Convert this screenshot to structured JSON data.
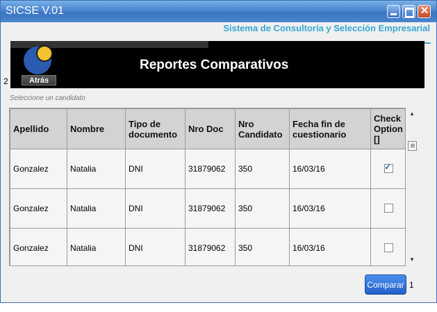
{
  "window": {
    "title": "SICSE V.01"
  },
  "brand": "Sistema de Consultoría y Selección Empresarial",
  "page_title": "Reportes Comparativos",
  "back": {
    "label": "Atrás",
    "badge": "2"
  },
  "hint": "Seleccione un candidato",
  "table": {
    "headers": [
      "Apellido",
      "Nombre",
      "Tipo de documento",
      "Nro Doc",
      "Nro Candidato",
      "Fecha fin de cuestionario",
      "Check Option []"
    ],
    "rows": [
      {
        "apellido": "Gonzalez",
        "nombre": "Natalia",
        "tipo": "DNI",
        "nro_doc": "31879062",
        "nro_candidato": "350",
        "fecha": "16/03/16",
        "checked": true
      },
      {
        "apellido": "Gonzalez",
        "nombre": "Natalia",
        "tipo": "DNI",
        "nro_doc": "31879062",
        "nro_candidato": "350",
        "fecha": "16/03/16",
        "checked": false
      },
      {
        "apellido": "Gonzalez",
        "nombre": "Natalia",
        "tipo": "DNI",
        "nro_doc": "31879062",
        "nro_candidato": "350",
        "fecha": "16/03/16",
        "checked": false
      }
    ]
  },
  "compare": {
    "label": "Comparar",
    "badge": "1"
  },
  "colors": {
    "titlebar": "#4a86cf",
    "brand": "#35a8d5",
    "banner": "#000000",
    "button": "#2460c8"
  }
}
